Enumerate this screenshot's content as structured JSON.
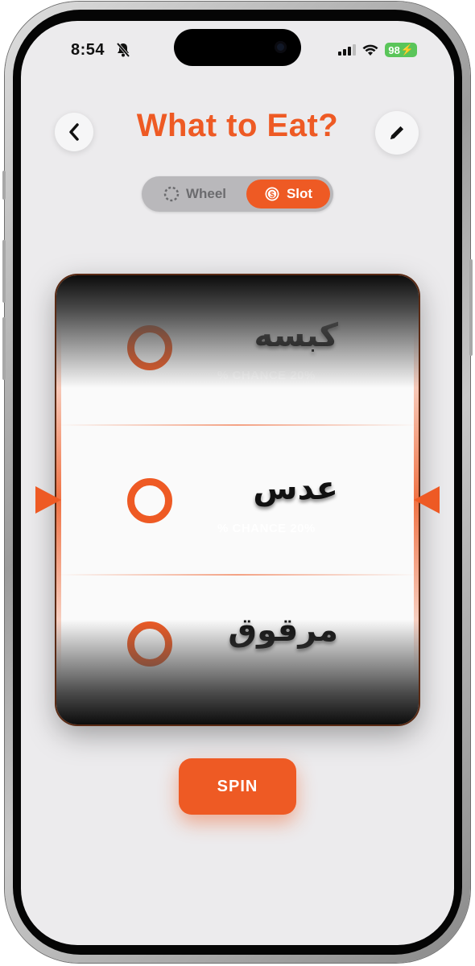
{
  "status_bar": {
    "time": "8:54",
    "battery": "98"
  },
  "header": {
    "title": "What to Eat?",
    "back_icon": "chevron-left-icon",
    "edit_icon": "pencil-icon"
  },
  "mode_toggle": {
    "options": [
      {
        "label": "Wheel",
        "icon": "dashed-circle-icon",
        "selected": false
      },
      {
        "label": "Slot",
        "icon": "coin-icon",
        "selected": true
      }
    ]
  },
  "slot": {
    "items": [
      {
        "name": "كبسه",
        "chance": "% CHANCE 20%"
      },
      {
        "name": "عدس",
        "chance": "% CHANCE 20%"
      },
      {
        "name": "مرقوق",
        "chance": ""
      }
    ]
  },
  "spin_button": {
    "label": "SPIN"
  },
  "colors": {
    "accent": "#ee5a24",
    "background": "#ecebed",
    "text": "#111111"
  }
}
